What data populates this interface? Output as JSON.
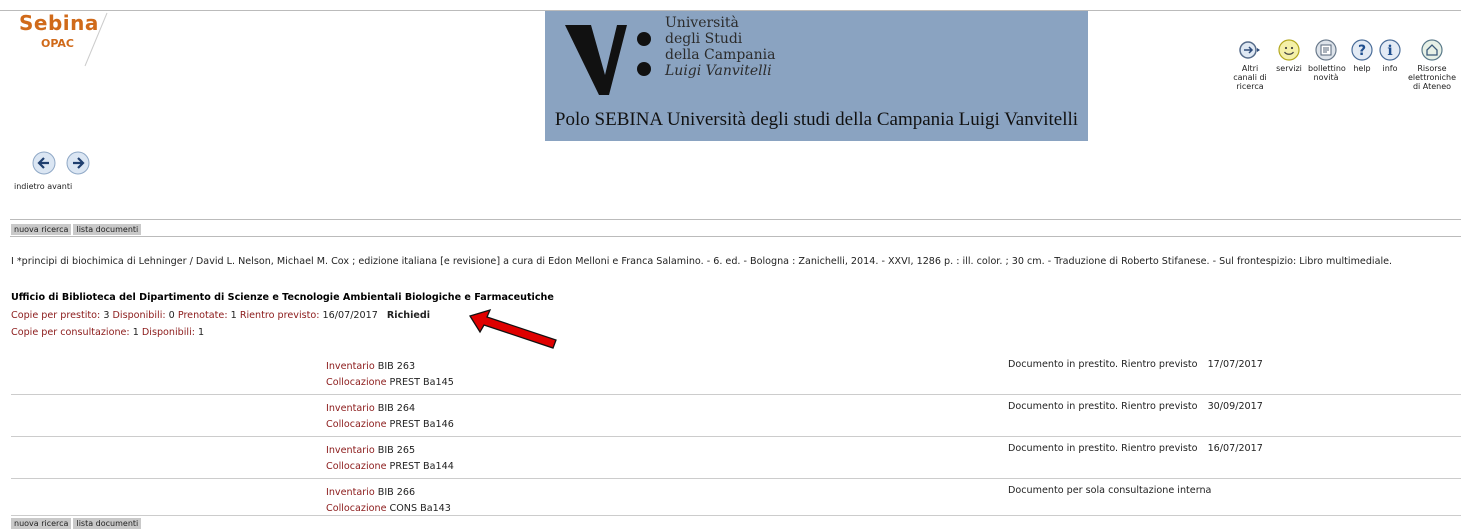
{
  "header": {
    "logo_title": "Sebina",
    "logo_sub": "OPAC",
    "university_lines": [
      "Università",
      "degli Studi",
      "della Campania",
      "Luigi Vanvitelli"
    ],
    "banner_caption": "Polo SEBINA Università degli studi della Campania Luigi Vanvitelli"
  },
  "toolbar": [
    {
      "label": "Altri canali di ricerca",
      "icon": "search-channels-icon"
    },
    {
      "label": "servizi",
      "icon": "smiley-icon"
    },
    {
      "label": "bollettino novità",
      "icon": "newspaper-icon"
    },
    {
      "label": "help",
      "icon": "help-icon"
    },
    {
      "label": "info",
      "icon": "info-icon"
    },
    {
      "label": "Risorse elettroniche di Ateneo",
      "icon": "home-icon"
    }
  ],
  "nav": {
    "back_label": "indietro",
    "forward_label": "avanti"
  },
  "tabs": {
    "new_search": "nuova ricerca",
    "doc_list": "lista documenti"
  },
  "record": {
    "description": "I *principi di biochimica di Lehninger / David L. Nelson, Michael M. Cox ; edizione italiana [e revisione] a cura di Edon Melloni e Franca Salamino. - 6. ed. - Bologna : Zanichelli, 2014. - XXVI, 1286 p. : ill. color. ; 30 cm. - Traduzione di Roberto Stifanese. - Sul frontespizio: Libro multimediale."
  },
  "holdings": {
    "office": "Ufficio di Biblioteca del Dipartimento di Scienze e Tecnologie Ambientali Biologiche e Farmaceutiche",
    "loan": {
      "copies_label": "Copie per prestito:",
      "copies": "3",
      "available_label": "Disponibili:",
      "available": "0",
      "reserved_label": "Prenotate:",
      "reserved": "1",
      "return_label": "Rientro previsto:",
      "return_date": "16/07/2017",
      "request_label": "Richiedi"
    },
    "consult": {
      "copies_label": "Copie per consultazione:",
      "copies": "1",
      "available_label": "Disponibili:",
      "available": "1"
    },
    "items": [
      {
        "inv_label": "Inventario",
        "inv": "BIB 263",
        "coll_label": "Collocazione",
        "coll": "PREST Ba145",
        "status": "Documento in prestito. Rientro previsto",
        "date": "17/07/2017"
      },
      {
        "inv_label": "Inventario",
        "inv": "BIB 264",
        "coll_label": "Collocazione",
        "coll": "PREST Ba146",
        "status": "Documento in prestito. Rientro previsto",
        "date": "30/09/2017"
      },
      {
        "inv_label": "Inventario",
        "inv": "BIB 265",
        "coll_label": "Collocazione",
        "coll": "PREST Ba144",
        "status": "Documento in prestito. Rientro previsto",
        "date": "16/07/2017"
      },
      {
        "inv_label": "Inventario",
        "inv": "BIB 266",
        "coll_label": "Collocazione",
        "coll": "CONS Ba143",
        "status": "Documento per sola consultazione interna",
        "date": ""
      }
    ]
  },
  "colors": {
    "label_red": "#8b1a1a",
    "banner_blue": "#8aa3c1",
    "logo_orange": "#d06a1a",
    "arrow_red": "#e00000"
  }
}
